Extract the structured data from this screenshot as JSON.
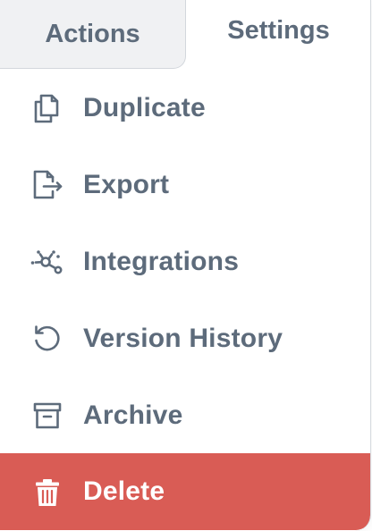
{
  "tabs": [
    {
      "label": "Actions",
      "active": false
    },
    {
      "label": "Settings",
      "active": true
    }
  ],
  "menu": {
    "items": [
      {
        "label": "Duplicate",
        "icon": "duplicate-icon"
      },
      {
        "label": "Export",
        "icon": "export-icon"
      },
      {
        "label": "Integrations",
        "icon": "integrations-icon"
      },
      {
        "label": "Version History",
        "icon": "version-history-icon"
      },
      {
        "label": "Archive",
        "icon": "archive-icon"
      },
      {
        "label": "Delete",
        "icon": "trash-icon"
      }
    ]
  },
  "colors": {
    "text": "#5d6b7b",
    "danger": "#d95c55",
    "inactive_tab_bg": "#f0f1f3"
  }
}
